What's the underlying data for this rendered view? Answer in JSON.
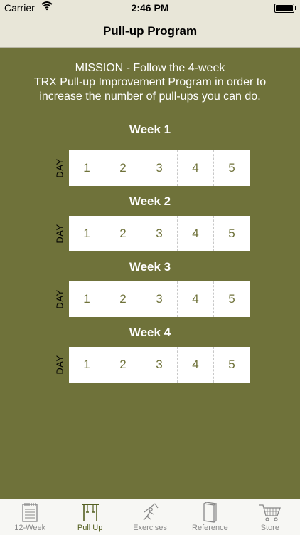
{
  "status_bar": {
    "carrier": "Carrier",
    "time": "2:46 PM"
  },
  "nav": {
    "title": "Pull-up Program"
  },
  "mission": [
    "MISSION - Follow the 4-week",
    "TRX Pull-up Improvement Program in order to",
    "increase the number of pull-ups you can do."
  ],
  "day_label": "DAY",
  "weeks": [
    {
      "title": "Week 1",
      "days": [
        "1",
        "2",
        "3",
        "4",
        "5"
      ]
    },
    {
      "title": "Week 2",
      "days": [
        "1",
        "2",
        "3",
        "4",
        "5"
      ]
    },
    {
      "title": "Week 3",
      "days": [
        "1",
        "2",
        "3",
        "4",
        "5"
      ]
    },
    {
      "title": "Week 4",
      "days": [
        "1",
        "2",
        "3",
        "4",
        "5"
      ]
    }
  ],
  "tabs": [
    {
      "label": "12-Week",
      "icon": "notepad-icon",
      "active": false
    },
    {
      "label": "Pull Up",
      "icon": "pullup-bar-icon",
      "active": true
    },
    {
      "label": "Exercises",
      "icon": "exercise-figure-icon",
      "active": false
    },
    {
      "label": "Reference",
      "icon": "book-icon",
      "active": false
    },
    {
      "label": "Store",
      "icon": "cart-icon",
      "active": false
    }
  ],
  "colors": {
    "background": "#6f723a",
    "bar": "#e8e6d8",
    "day_number": "#6f723a",
    "active_tab": "#556022"
  }
}
